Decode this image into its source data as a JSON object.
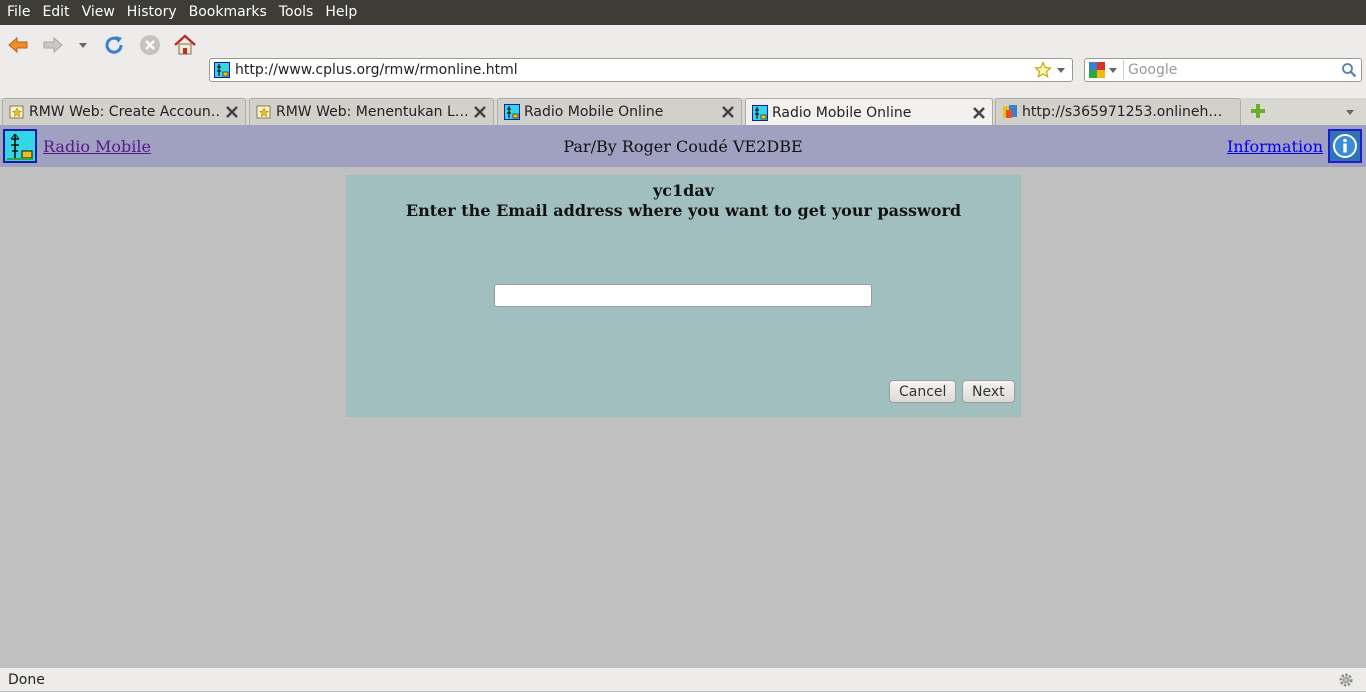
{
  "menubar": {
    "items": [
      "File",
      "Edit",
      "View",
      "History",
      "Bookmarks",
      "Tools",
      "Help"
    ]
  },
  "toolbar": {
    "back_icon": "back-arrow-icon",
    "forward_icon": "forward-arrow-icon",
    "reload_icon": "reload-icon",
    "stop_icon": "stop-icon",
    "home_icon": "home-icon",
    "url": "http://www.cplus.org/rmw/rmonline.html",
    "search_placeholder": "Google"
  },
  "tabs": [
    {
      "label": "RMW Web: Create Accoun…",
      "icon": "bookmark-page-icon",
      "active": false
    },
    {
      "label": "RMW Web: Menentukan L…",
      "icon": "bookmark-page-icon",
      "active": false
    },
    {
      "label": "Radio Mobile Online",
      "icon": "radio-mobile-favicon",
      "active": false
    },
    {
      "label": "Radio Mobile Online",
      "icon": "radio-mobile-favicon",
      "active": true
    },
    {
      "label": "http://s365971253.onlineh…",
      "icon": "generic-page-icon",
      "active": false
    }
  ],
  "header": {
    "home_link": "Radio Mobile",
    "author": "Par/By Roger Coudé VE2DBE",
    "info_link": "Information"
  },
  "panel": {
    "username": "yc1dav",
    "prompt": "Enter the Email address where you want to get your password",
    "email_value": "",
    "cancel_label": "Cancel",
    "next_label": "Next"
  },
  "status": {
    "text": "Done"
  },
  "colors": {
    "menubar": "#3d3c37",
    "header": "#a0a0c0",
    "panel": "#a2bfbf",
    "page_background": "#c0c0c0",
    "visited_link": "#551a8b",
    "link": "#0000ee"
  }
}
